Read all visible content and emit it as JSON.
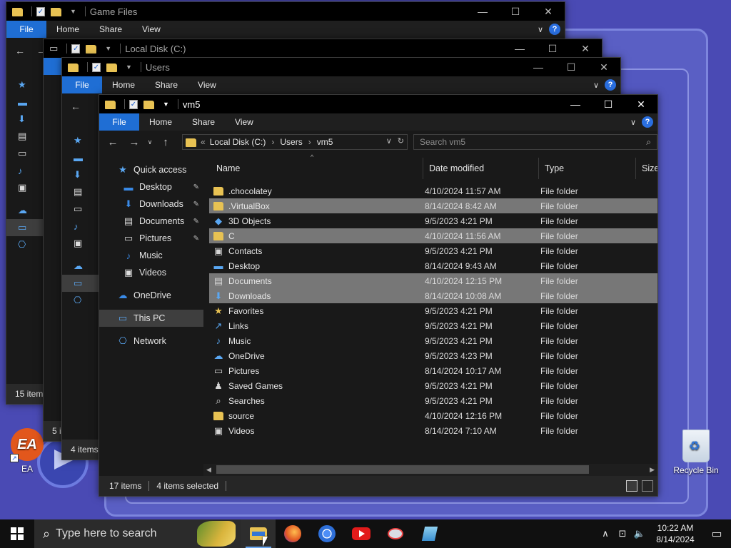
{
  "desktop": {
    "icons": [
      {
        "label": "EA"
      },
      {
        "label": "Recycle Bin"
      }
    ]
  },
  "windows": {
    "game_files": {
      "title": "Game Files",
      "tabs": [
        "File",
        "Home",
        "Share",
        "View"
      ],
      "status": "15 item"
    },
    "local_disk": {
      "title": "Local Disk (C:)",
      "status": "5 i"
    },
    "users": {
      "title": "Users",
      "tabs": [
        "File",
        "Home",
        "Share",
        "View"
      ],
      "status": "4 items"
    },
    "vm5": {
      "title": "vm5",
      "tabs": [
        "File",
        "Home",
        "Share",
        "View"
      ],
      "address": {
        "root_chevron": "«",
        "crumbs": [
          "Local Disk (C:)",
          "Users",
          "vm5"
        ]
      },
      "search": {
        "placeholder": "Search vm5"
      },
      "nav": [
        {
          "label": "Quick access",
          "icon": "star-icon"
        },
        {
          "label": "Desktop",
          "icon": "desktop-icon",
          "pinned": true
        },
        {
          "label": "Downloads",
          "icon": "download-icon",
          "pinned": true
        },
        {
          "label": "Documents",
          "icon": "document-icon",
          "pinned": true
        },
        {
          "label": "Pictures",
          "icon": "pictures-icon",
          "pinned": true
        },
        {
          "label": "Music",
          "icon": "music-icon"
        },
        {
          "label": "Videos",
          "icon": "videos-icon"
        },
        {
          "label": "OneDrive",
          "icon": "cloud-icon"
        },
        {
          "label": "This PC",
          "icon": "computer-icon",
          "selected": true
        },
        {
          "label": "Network",
          "icon": "network-icon"
        }
      ],
      "columns": [
        "Name",
        "Date modified",
        "Type",
        "Size"
      ],
      "files": [
        {
          "name": ".chocolatey",
          "date": "4/10/2024 11:57 AM",
          "type": "File folder",
          "icon": "folder-icon",
          "selected": false
        },
        {
          "name": ".VirtualBox",
          "date": "8/14/2024 8:42 AM",
          "type": "File folder",
          "icon": "folder-icon",
          "selected": true
        },
        {
          "name": "3D Objects",
          "date": "9/5/2023 4:21 PM",
          "type": "File folder",
          "icon": "3d-objects-icon",
          "selected": false
        },
        {
          "name": "C",
          "date": "4/10/2024 11:56 AM",
          "type": "File folder",
          "icon": "folder-icon",
          "selected": true
        },
        {
          "name": "Contacts",
          "date": "9/5/2023 4:21 PM",
          "type": "File folder",
          "icon": "contacts-icon",
          "selected": false
        },
        {
          "name": "Desktop",
          "date": "8/14/2024 9:43 AM",
          "type": "File folder",
          "icon": "desktop-icon",
          "selected": false
        },
        {
          "name": "Documents",
          "date": "4/10/2024 12:15 PM",
          "type": "File folder",
          "icon": "document-icon",
          "selected": true
        },
        {
          "name": "Downloads",
          "date": "8/14/2024 10:08 AM",
          "type": "File folder",
          "icon": "download-icon",
          "selected": true
        },
        {
          "name": "Favorites",
          "date": "9/5/2023 4:21 PM",
          "type": "File folder",
          "icon": "star-icon",
          "selected": false
        },
        {
          "name": "Links",
          "date": "9/5/2023 4:21 PM",
          "type": "File folder",
          "icon": "links-icon",
          "selected": false
        },
        {
          "name": "Music",
          "date": "9/5/2023 4:21 PM",
          "type": "File folder",
          "icon": "music-icon",
          "selected": false
        },
        {
          "name": "OneDrive",
          "date": "9/5/2023 4:23 PM",
          "type": "File folder",
          "icon": "cloud-icon",
          "selected": false
        },
        {
          "name": "Pictures",
          "date": "8/14/2024 10:17 AM",
          "type": "File folder",
          "icon": "pictures-icon",
          "selected": false
        },
        {
          "name": "Saved Games",
          "date": "9/5/2023 4:21 PM",
          "type": "File folder",
          "icon": "saved-games-icon",
          "selected": false
        },
        {
          "name": "Searches",
          "date": "9/5/2023 4:21 PM",
          "type": "File folder",
          "icon": "search-icon",
          "selected": false
        },
        {
          "name": "source",
          "date": "4/10/2024 12:16 PM",
          "type": "File folder",
          "icon": "folder-icon",
          "selected": false
        },
        {
          "name": "Videos",
          "date": "8/14/2024 7:10 AM",
          "type": "File folder",
          "icon": "videos-icon",
          "selected": false
        }
      ],
      "status": {
        "items": "17 items",
        "selected": "4 items selected"
      }
    }
  },
  "taskbar": {
    "search_placeholder": "Type here to search",
    "apps": [
      "file-explorer-icon",
      "firefox-icon",
      "chrome-icon",
      "youtube-icon",
      "app-icon",
      "notepad-icon"
    ],
    "time": "10:22 AM",
    "date": "8/14/2024"
  },
  "colors": {
    "accent": "#1f6ed4",
    "folder": "#e8c253",
    "selection": "#777777"
  }
}
